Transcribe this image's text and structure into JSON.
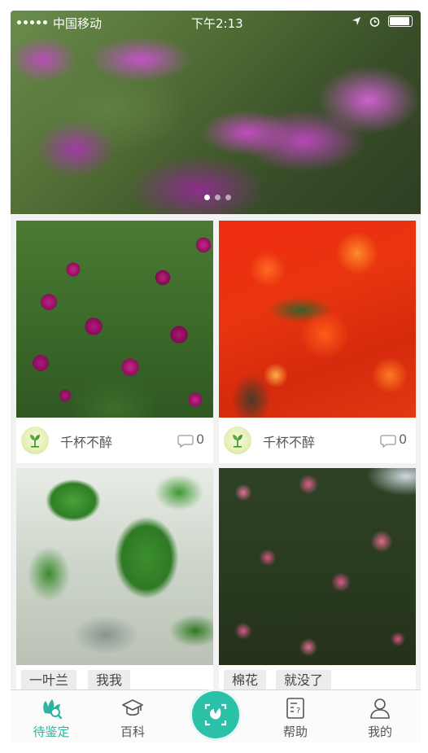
{
  "status_bar": {
    "carrier": "中国移动",
    "time": "下午2:13",
    "icons": [
      "signal-dots-icon",
      "wifi-icon",
      "location-arrow-icon",
      "alarm-icon",
      "battery-icon"
    ]
  },
  "banner": {
    "dots_count": 3,
    "active_index": 0
  },
  "cards": [
    {
      "author": "千杯不醉",
      "comments": "0"
    },
    {
      "author": "千杯不醉",
      "comments": "0"
    },
    {
      "tags": [
        "一叶兰",
        "我我"
      ]
    },
    {
      "tags": [
        "棉花",
        "就没了"
      ]
    }
  ],
  "tabbar": {
    "items": [
      {
        "label": "待鉴定",
        "icon": "flower-search-icon",
        "active": true
      },
      {
        "label": "百科",
        "icon": "graduation-cap-icon",
        "active": false
      },
      {
        "label": "",
        "icon": "scan-flower-icon",
        "active": false
      },
      {
        "label": "帮助",
        "icon": "help-document-icon",
        "active": false
      },
      {
        "label": "我的",
        "icon": "person-icon",
        "active": false
      }
    ]
  },
  "colors": {
    "accent": "#2bb5a0",
    "scan_button": "#2bc0a8",
    "tab_text": "#555555",
    "background": "#f2f2f2"
  }
}
